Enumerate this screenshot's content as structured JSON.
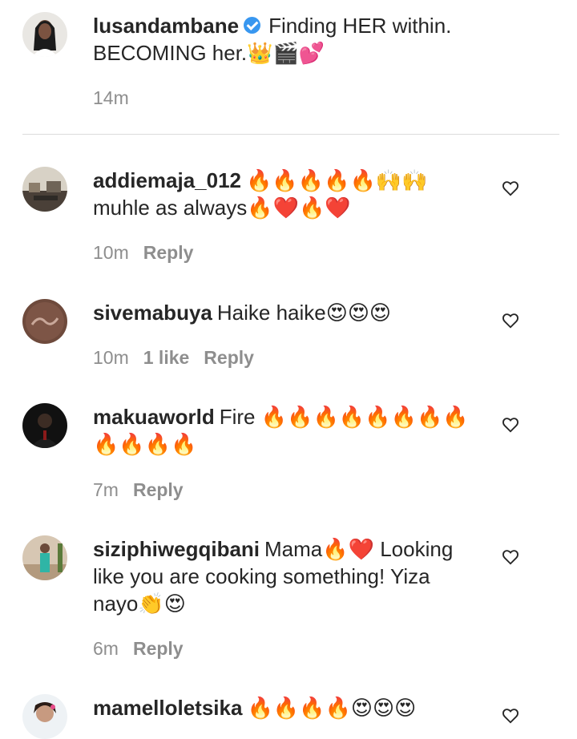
{
  "caption": {
    "username": "lusandambane",
    "text": "Finding HER within. BECOMING her.👑🎬💕",
    "time": "14m"
  },
  "comments": [
    {
      "username": "addiemaja_012",
      "text": "🔥🔥🔥🔥🔥🙌🙌 muhle as always🔥❤️🔥❤️",
      "time": "10m",
      "likes": "",
      "reply": "Reply"
    },
    {
      "username": "sivemabuya",
      "text": "Haike haike😍😍😍",
      "time": "10m",
      "likes": "1 like",
      "reply": "Reply"
    },
    {
      "username": "makuaworld",
      "text": "Fire 🔥🔥🔥🔥🔥🔥🔥🔥🔥🔥🔥🔥",
      "time": "7m",
      "likes": "",
      "reply": "Reply"
    },
    {
      "username": "siziphiwegqibani",
      "text": "Mama🔥❤️ Looking like you are cooking something! Yiza nayo👏😍",
      "time": "6m",
      "likes": "",
      "reply": "Reply"
    },
    {
      "username": "mamelloletsika",
      "text": "🔥🔥🔥🔥😍😍😍",
      "time": "",
      "likes": "",
      "reply": ""
    }
  ],
  "icons": {
    "like": "heart-outline-icon",
    "verified": "verified-badge-icon"
  },
  "colors": {
    "text": "#262626",
    "meta": "#8e8e8e",
    "verified": "#3897f0",
    "divider": "#dbdbdb"
  }
}
